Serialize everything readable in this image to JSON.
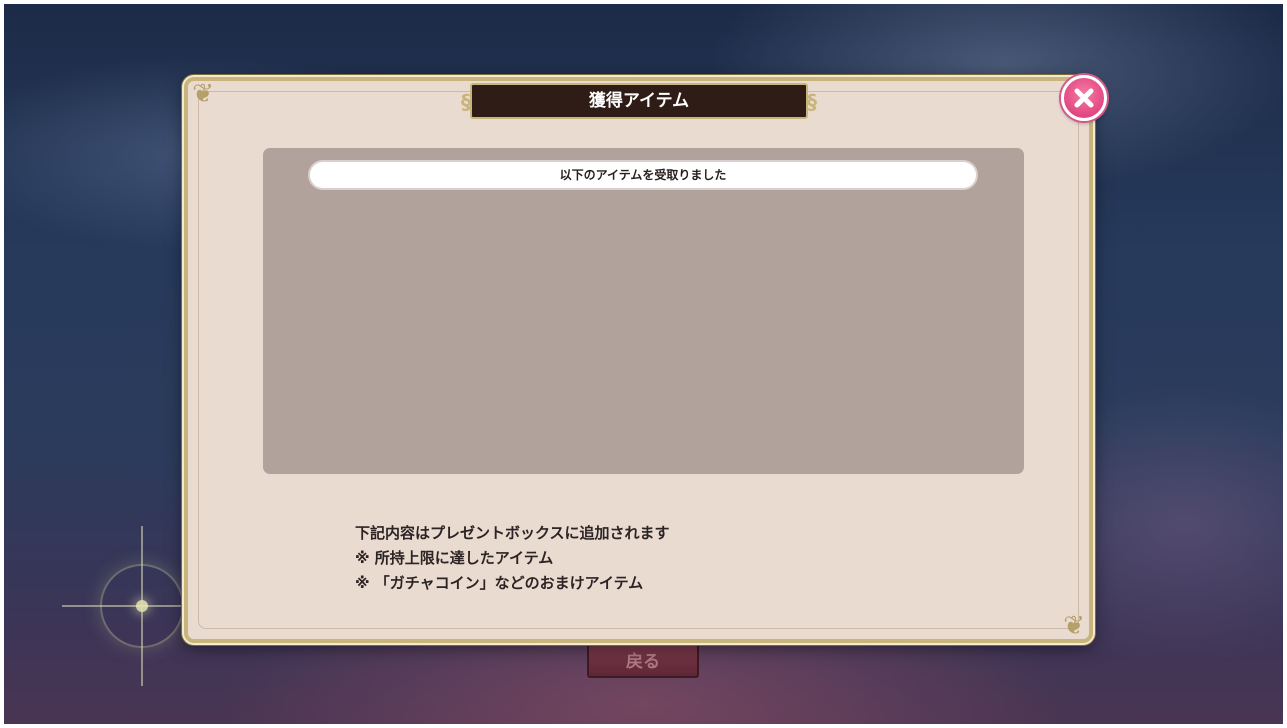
{
  "background": {
    "back_button_label": "戻る"
  },
  "dialog": {
    "title": "獲得アイテム",
    "close_icon": "close-icon",
    "panel_header": "以下のアイテムを受取りました",
    "notes": [
      "下記内容はプレゼントボックスに追加されます",
      "※ 所持上限に達したアイテム",
      "※ 「ガチャコイン」などのおまけアイテム"
    ]
  },
  "colors": {
    "dialog_bg": "#eadbd1",
    "panel_bg": "#b1a29c",
    "title_bg": "#2f1c16",
    "frame_gold": "#c8b57c",
    "close_pink": "#e14882"
  }
}
